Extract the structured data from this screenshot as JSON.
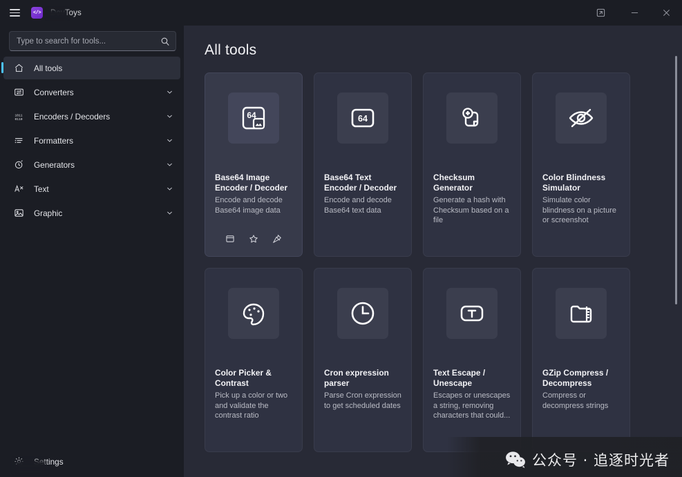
{
  "window": {
    "app_name": "DevToys",
    "title": "DevToys",
    "menu_icon": "hamburger-icon",
    "logo_glyph": "</>",
    "controls": {
      "compact_overlay_label": "Compact overlay",
      "minimize_label": "Minimize",
      "close_label": "Close"
    }
  },
  "sidebar": {
    "search": {
      "placeholder": "Type to search for tools...",
      "value": "",
      "icon": "search-icon"
    },
    "items": [
      {
        "label": "All tools",
        "icon": "home-icon",
        "selected": true,
        "expandable": false
      },
      {
        "label": "Converters",
        "icon": "converter-icon",
        "selected": false,
        "expandable": true
      },
      {
        "label": "Encoders / Decoders",
        "icon": "binary-icon",
        "selected": false,
        "expandable": true
      },
      {
        "label": "Formatters",
        "icon": "format-icon",
        "selected": false,
        "expandable": true
      },
      {
        "label": "Generators",
        "icon": "generate-icon",
        "selected": false,
        "expandable": true
      },
      {
        "label": "Text",
        "icon": "text-icon",
        "selected": false,
        "expandable": true
      },
      {
        "label": "Graphic",
        "icon": "image-icon",
        "selected": false,
        "expandable": true
      }
    ],
    "footer": {
      "label": "Settings",
      "icon": "gear-icon"
    }
  },
  "main": {
    "title": "All tools",
    "cards": [
      {
        "title": "Base64 Image Encoder / Decoder",
        "desc": "Encode and decode Base64 image data",
        "icon": "base64-image-icon",
        "hovered": true,
        "actions": [
          {
            "label": "Open in new window",
            "icon": "new-window-icon"
          },
          {
            "label": "Add to favorites",
            "icon": "star-icon"
          },
          {
            "label": "Pin tool",
            "icon": "pin-icon"
          }
        ]
      },
      {
        "title": "Base64 Text Encoder / Decoder",
        "desc": "Encode and decode Base64 text data",
        "icon": "base64-text-icon",
        "hovered": false,
        "actions": []
      },
      {
        "title": "Checksum Generator",
        "desc": "Generate a hash with Checksum based on a file",
        "icon": "checksum-icon",
        "hovered": false,
        "actions": []
      },
      {
        "title": "Color Blindness Simulator",
        "desc": "Simulate color blindness on a picture or screenshot",
        "icon": "eye-off-icon",
        "hovered": false,
        "actions": []
      },
      {
        "title": "Color Picker & Contrast",
        "desc": "Pick up a color or two and validate the contrast ratio",
        "icon": "palette-icon",
        "hovered": false,
        "actions": []
      },
      {
        "title": "Cron expression parser",
        "desc": "Parse Cron expression to get scheduled dates",
        "icon": "clock-icon",
        "hovered": false,
        "actions": []
      },
      {
        "title": "Text Escape / Unescape",
        "desc": "Escapes or unescapes a string, removing characters that could...",
        "icon": "text-box-icon",
        "hovered": false,
        "actions": []
      },
      {
        "title": "GZip Compress / Decompress",
        "desc": "Compress or decompress strings",
        "icon": "zip-folder-icon",
        "hovered": false,
        "actions": []
      }
    ]
  },
  "watermark": {
    "icon": "wechat-icon",
    "text": "公众号 · 追逐时光者"
  },
  "colors": {
    "accent": "#4cc2ff",
    "logo_purple": "#7c36d6",
    "window_chrome": "#1b1d24",
    "content_bg": "#282a36",
    "card_bg": "#2f3242",
    "card_hover_bg": "#373a4a"
  }
}
